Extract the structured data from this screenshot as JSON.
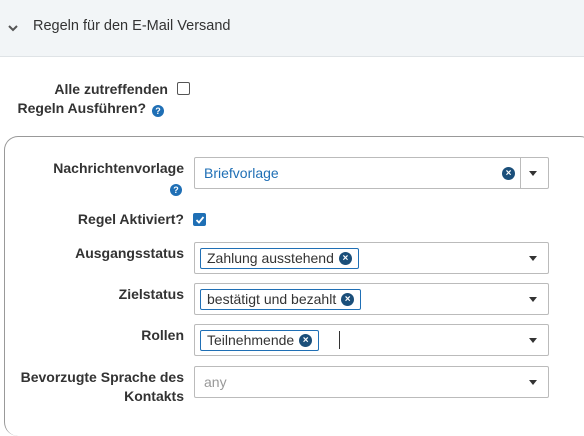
{
  "panel": {
    "title": "Regeln für den E-Mail Versand",
    "collapse_icon": "chevron-down-icon"
  },
  "execute_all": {
    "label_line1": "Alle zutreffenden",
    "label_line2": "Regeln Ausführen?",
    "checked": false,
    "help": "?"
  },
  "rule": {
    "template": {
      "label": "Nachrichtenvorlage",
      "help": "?",
      "value": "Briefvorlage",
      "clear": "×"
    },
    "enabled": {
      "label": "Regel Aktiviert?",
      "checked": true
    },
    "source_status": {
      "label": "Ausgangsstatus",
      "tags": [
        "Zahlung ausstehend"
      ]
    },
    "target_status": {
      "label": "Zielstatus",
      "tags": [
        "bestätigt und bezahlt"
      ]
    },
    "roles": {
      "label": "Rollen",
      "tags": [
        "Teilnehmende"
      ]
    },
    "language": {
      "label_line1": "Bevorzugte Sprache des",
      "label_line2": "Kontakts",
      "placeholder": "any"
    }
  }
}
